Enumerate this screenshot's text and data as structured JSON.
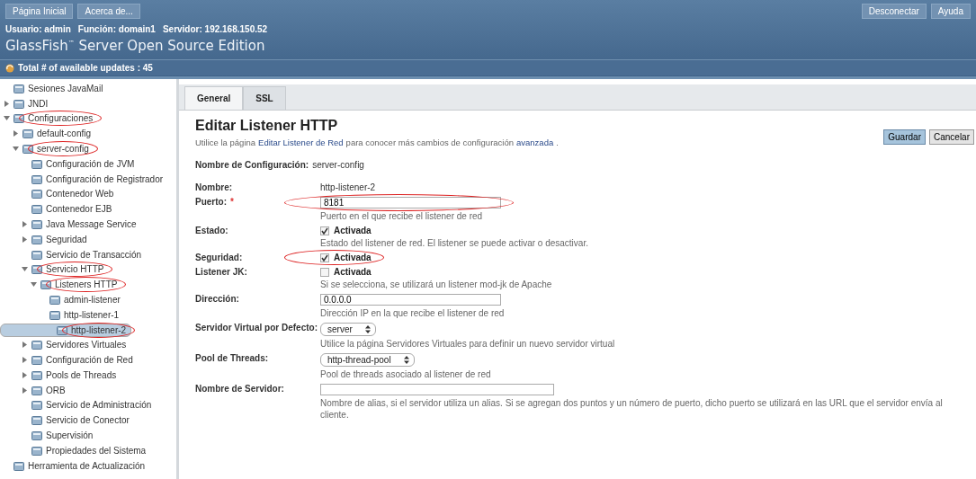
{
  "header": {
    "nav_buttons": [
      "Página Inicial",
      "Acerca de..."
    ],
    "right_buttons": [
      "Desconectar",
      "Ayuda"
    ],
    "user_info": [
      {
        "label": "Usuario:",
        "value": "admin"
      },
      {
        "label": "Función:",
        "value": "domain1"
      },
      {
        "label": "Servidor:",
        "value": "192.168.150.52"
      }
    ],
    "product_name": "GlassFish",
    "product_mark": "™",
    "product_rest": " Server Open Source Edition",
    "updates": "Total # of available updates : 45"
  },
  "sidebar": {
    "items": [
      {
        "label": "Sesiones JavaMail",
        "circled": false,
        "selected": false
      },
      {
        "label": "JNDI",
        "expanded": false,
        "circled": false,
        "selected": false
      },
      {
        "label": "Configuraciones",
        "expanded": true,
        "circled": true,
        "selected": false,
        "children": [
          {
            "label": "default-config",
            "expanded": false,
            "circled": false,
            "selected": false
          },
          {
            "label": "server-config",
            "expanded": true,
            "circled": true,
            "selected": false,
            "children": [
              {
                "label": "Configuración de JVM",
                "circled": false,
                "selected": false
              },
              {
                "label": "Configuración de Registrador",
                "circled": false,
                "selected": false
              },
              {
                "label": "Contenedor Web",
                "circled": false,
                "selected": false
              },
              {
                "label": "Contenedor EJB",
                "circled": false,
                "selected": false
              },
              {
                "label": "Java Message Service",
                "expanded": false,
                "circled": false,
                "selected": false
              },
              {
                "label": "Seguridad",
                "expanded": false,
                "circled": false,
                "selected": false
              },
              {
                "label": "Servicio de Transacción",
                "circled": false,
                "selected": false
              },
              {
                "label": "Servicio HTTP",
                "expanded": true,
                "circled": true,
                "selected": false,
                "children": [
                  {
                    "label": "Listeners HTTP",
                    "expanded": true,
                    "circled": true,
                    "selected": false,
                    "children": [
                      {
                        "label": "admin-listener",
                        "circled": false,
                        "selected": false
                      },
                      {
                        "label": "http-listener-1",
                        "circled": false,
                        "selected": false
                      },
                      {
                        "label": "http-listener-2",
                        "circled": true,
                        "selected": true
                      }
                    ]
                  }
                ]
              },
              {
                "label": "Servidores Virtuales",
                "expanded": false,
                "circled": false,
                "selected": false
              },
              {
                "label": "Configuración de Red",
                "expanded": false,
                "circled": false,
                "selected": false
              },
              {
                "label": "Pools de Threads",
                "expanded": false,
                "circled": false,
                "selected": false
              },
              {
                "label": "ORB",
                "expanded": false,
                "circled": false,
                "selected": false
              },
              {
                "label": "Servicio de Administración",
                "circled": false,
                "selected": false
              },
              {
                "label": "Servicio de Conector",
                "circled": false,
                "selected": false
              },
              {
                "label": "Supervisión",
                "circled": false,
                "selected": false
              },
              {
                "label": "Propiedades del Sistema",
                "circled": false,
                "selected": false
              }
            ]
          }
        ]
      },
      {
        "label": "Herramienta de Actualización",
        "circled": false,
        "selected": false
      }
    ]
  },
  "tabs": [
    {
      "label": "General",
      "selected": true
    },
    {
      "label": "SSL",
      "selected": false
    }
  ],
  "page": {
    "title": "Editar Listener HTTP",
    "description": [
      {
        "kind": "text",
        "text": "Utilice la página"
      },
      {
        "kind": "link",
        "text": "Editar Listener de Red"
      },
      {
        "kind": "text",
        "text": "para conocer más cambios de configuración"
      },
      {
        "kind": "link",
        "text": "avanzada"
      },
      {
        "kind": "text",
        "text": "."
      }
    ],
    "buttons": [
      {
        "label": "Guardar",
        "primary": true
      },
      {
        "label": "Cancelar",
        "primary": false
      }
    ],
    "config_name": {
      "label": "Nombre de Configuración:",
      "value": "server-config"
    },
    "fields": [
      {
        "kind": "text",
        "label": "Nombre:",
        "value": "http-listener-2",
        "required": false,
        "circled": false
      },
      {
        "kind": "input",
        "label": "Puerto:",
        "value": "8181",
        "required": true,
        "required_mark": "*",
        "circled": true,
        "help": "Puerto en el que recibe el listener de red"
      },
      {
        "kind": "checkbox",
        "label": "Estado:",
        "option": "Activada",
        "checked": true,
        "required": false,
        "circled": false,
        "help": "Estado del listener de red. El listener se puede activar o desactivar."
      },
      {
        "kind": "checkbox",
        "label": "Seguridad:",
        "option": "Activada",
        "checked": true,
        "required": false,
        "circled": true
      },
      {
        "kind": "checkbox",
        "label": "Listener JK:",
        "option": "Activada",
        "checked": false,
        "required": false,
        "circled": false,
        "help": "Si se selecciona, se utilizará un listener mod-jk de Apache"
      },
      {
        "kind": "input",
        "label": "Dirección:",
        "value": "0.0.0.0",
        "required": false,
        "circled": false,
        "help": "Dirección IP en la que recibe el listener de red"
      },
      {
        "kind": "select",
        "label": "Servidor Virtual por Defecto:",
        "value": "server",
        "required": false,
        "circled": false,
        "help": "Utilice la página Servidores Virtuales para definir un nuevo servidor virtual"
      },
      {
        "kind": "select",
        "label": "Pool de Threads:",
        "value": "http-thread-pool",
        "required": false,
        "circled": false,
        "help": "Pool de threads asociado al listener de red"
      },
      {
        "kind": "input",
        "label": "Nombre de Servidor:",
        "required": false,
        "circled": false,
        "wide": true,
        "help": "Nombre de alias, si el servidor utiliza un alias. Si se agregan dos puntos y un número de puerto, dicho puerto se utilizará en las URL que el servidor envía al cliente."
      }
    ]
  }
}
